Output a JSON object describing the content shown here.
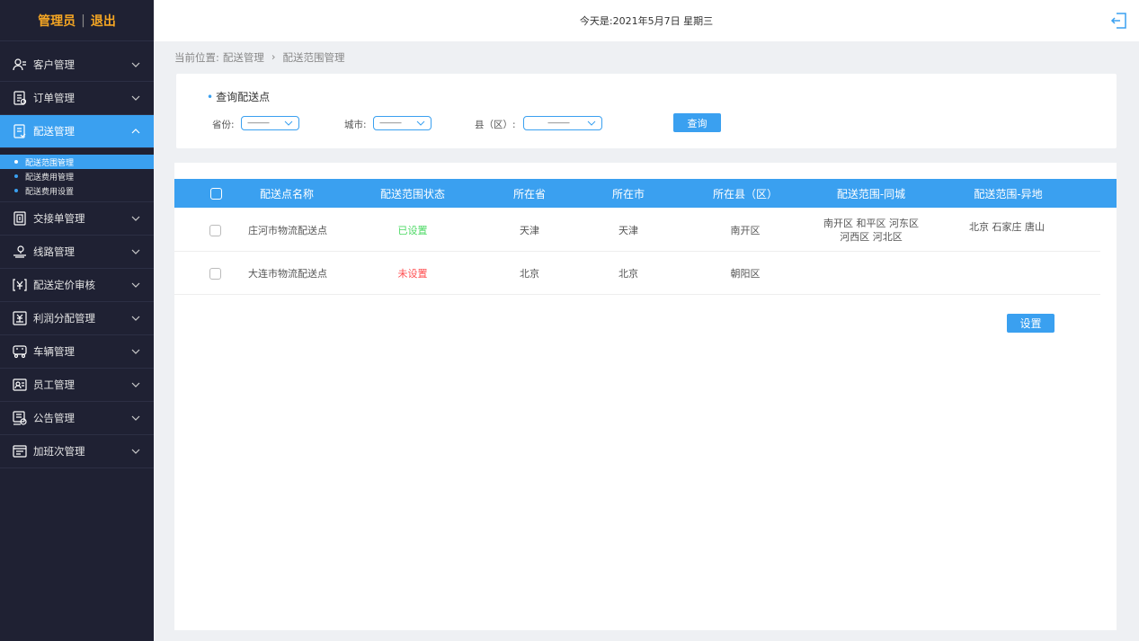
{
  "header": {
    "admin_label": "管理员",
    "separator": "|",
    "logout_label": "退出",
    "date_text": "今天是:2021年5月7日 星期三"
  },
  "sidebar": {
    "items": [
      {
        "label": "客户管理",
        "icon": "customer-icon"
      },
      {
        "label": "订单管理",
        "icon": "order-icon"
      },
      {
        "label": "配送管理",
        "icon": "delivery-icon"
      },
      {
        "label": "交接单管理",
        "icon": "handover-icon"
      },
      {
        "label": "线路管理",
        "icon": "route-icon"
      },
      {
        "label": "配送定价审核",
        "icon": "pricing-icon"
      },
      {
        "label": "利润分配管理",
        "icon": "profit-icon"
      },
      {
        "label": "车辆管理",
        "icon": "vehicle-icon"
      },
      {
        "label": "员工管理",
        "icon": "staff-icon"
      },
      {
        "label": "公告管理",
        "icon": "notice-icon"
      },
      {
        "label": "加班次管理",
        "icon": "shift-icon"
      }
    ],
    "submenu": [
      {
        "label": "配送范围管理"
      },
      {
        "label": "配送费用管理"
      },
      {
        "label": "配送费用设置"
      }
    ]
  },
  "breadcrumb": {
    "prefix": "当前位置:",
    "level1": "配送管理",
    "arrow": "›",
    "level2": "配送范围管理"
  },
  "query": {
    "title": "查询配送点",
    "province_label": "省份:",
    "city_label": "城市:",
    "county_label": "县（区）:",
    "province_value": "———",
    "city_value": "———",
    "county_value": "———",
    "button": "查询"
  },
  "table": {
    "columns": [
      "配送点名称",
      "配送范围状态",
      "所在省",
      "所在市",
      "所在县（区）",
      "配送范围-同城",
      "配送范围-异地"
    ],
    "rows": [
      {
        "name": "庄河市物流配送点",
        "status": "已设置",
        "province": "天津",
        "city": "天津",
        "county": "南开区",
        "local_line1": "南开区  和平区  河东区",
        "local_line2": "河西区  河北区",
        "remote": "北京  石家庄  唐山"
      },
      {
        "name": "大连市物流配送点",
        "status": "未设置",
        "province": "北京",
        "city": "北京",
        "county": "朝阳区",
        "local_line1": "",
        "local_line2": "",
        "remote": ""
      }
    ],
    "set_button": "设置"
  },
  "colors": {
    "accent": "#3aa0f0",
    "sidebar_bg": "#1f2133",
    "brand_orange": "#f5a623",
    "status_set": "#4cd964",
    "status_unset": "#ff4d4f"
  }
}
